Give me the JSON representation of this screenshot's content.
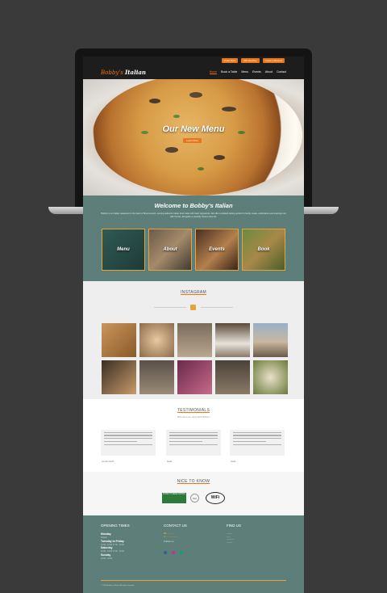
{
  "top_buttons": [
    "Order Now",
    "Gift Voucher",
    "Leave a Review"
  ],
  "logo": {
    "part1": "Bobby's",
    "part2": "Italian"
  },
  "nav": [
    "Home",
    "Book a Table",
    "Menu",
    "Events",
    "About",
    "Contact"
  ],
  "hero": {
    "title": "Our New Menu",
    "button": "Learn More"
  },
  "welcome": {
    "title": "Welcome to Bobby's Italian",
    "text": "Bobby's is an Italian restaurant in the heart of Bournemouth, serving authentic Italian food made with fresh ingredients. We offer a relaxed setting perfect for family meals, celebrations and evenings out with friends, alongside a carefully chosen wine list."
  },
  "tiles": [
    "Menu",
    "About",
    "Events",
    "Book"
  ],
  "instagram": {
    "title": "INSTAGRAM"
  },
  "testimonials": {
    "title": "TESTIMONIALS",
    "subtitle": "What others are saying about Bobby's",
    "names": [
      "Jennifer Smith",
      "Sarah",
      "Sarah"
    ]
  },
  "nice": {
    "title": "NICE TO KNOW",
    "wifi": "WiFi",
    "hygiene": "FOOD HYGIENE RATING",
    "badge2": "GO"
  },
  "footer": {
    "opening_title": "OPENING TIMES",
    "hours": [
      {
        "day": "Monday",
        "times": "Closed"
      },
      {
        "day": "Tuesday to Friday",
        "times": "12:00 - 14:30  17:30 - 22:00"
      },
      {
        "day": "Saturday",
        "times": "12:00 - 15:00  17:00 - 22:00"
      },
      {
        "day": "Sunday",
        "times": "12:00 - 21:00"
      }
    ],
    "contact_title": "CONTACT US",
    "follow": "Follow us",
    "find_title": "FIND US",
    "copyright": "© 2018 Bobby's Italian | All rights reserved"
  },
  "colors": {
    "accent": "#e8761a",
    "teal": "#5e7f79",
    "dark": "#1d1d1d"
  }
}
